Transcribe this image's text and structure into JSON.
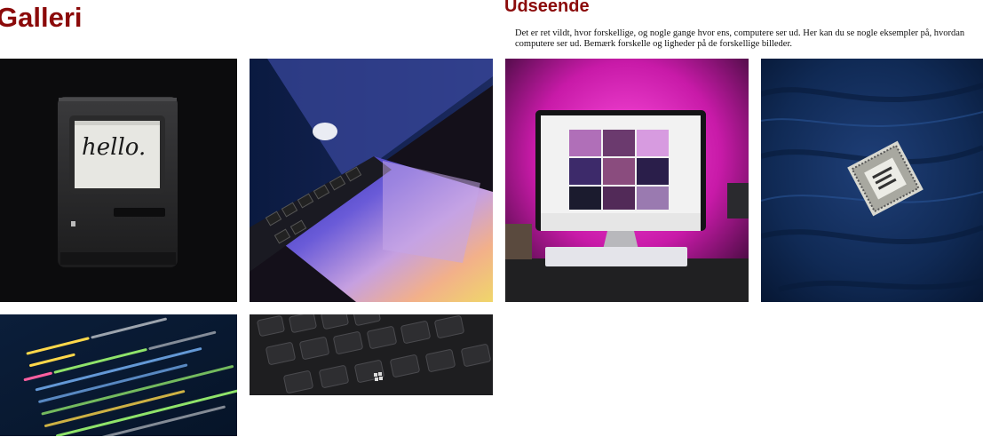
{
  "gallery": {
    "title": "Galleri",
    "images": [
      {
        "icon": "macintosh-hello-photo",
        "caption_text": "hello."
      },
      {
        "icon": "macbook-laptop-photo"
      },
      {
        "icon": "code-screen-photo"
      },
      {
        "icon": "keyboard-photo"
      }
    ]
  },
  "appearance": {
    "title": "Udseende",
    "intro_line1": "Det er ret vildt, hvor forskellige, og nogle gange hvor ens, computere ser ud. Her kan du se nogle eksempler på, hvordan",
    "intro_line2": "computere ser ud. Bemærk forskelle og ligheder på de forskellige billeder.",
    "images": [
      {
        "icon": "imac-desk-photo"
      },
      {
        "icon": "cpu-chip-photo"
      }
    ]
  },
  "colors": {
    "heading": "#8b0a0a"
  }
}
